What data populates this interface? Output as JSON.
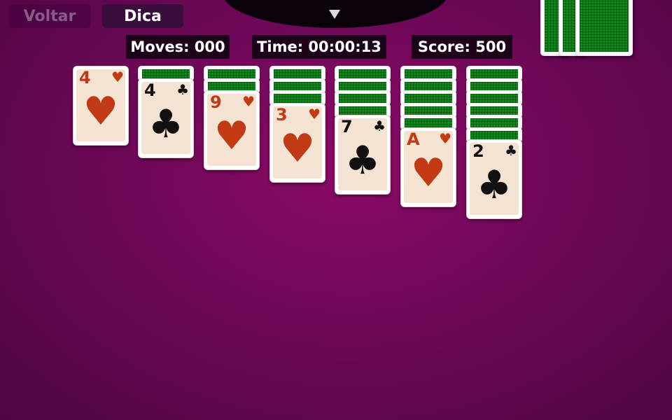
{
  "toolbar": {
    "back_label": "Voltar",
    "hint_label": "Dica"
  },
  "stats": {
    "moves": "Moves: 000",
    "time": "Time: 00:00:13",
    "score": "Score: 500"
  },
  "colors": {
    "table": "#7a0a5e",
    "red_suit": "#c23a14",
    "black_suit": "#111111",
    "card_back": "#0f8a1e",
    "card_face": "#f4e3d3"
  },
  "icons": {
    "menu": "triangle-down-icon",
    "hearts": "heart-icon",
    "clubs": "club-icon"
  },
  "tableau": [
    {
      "hidden": 0,
      "rank": "4",
      "suit": "♥",
      "color": "red"
    },
    {
      "hidden": 1,
      "rank": "4",
      "suit": "♣",
      "color": "black"
    },
    {
      "hidden": 2,
      "rank": "9",
      "suit": "♥",
      "color": "red"
    },
    {
      "hidden": 3,
      "rank": "3",
      "suit": "♥",
      "color": "red"
    },
    {
      "hidden": 4,
      "rank": "7",
      "suit": "♣",
      "color": "black"
    },
    {
      "hidden": 5,
      "rank": "A",
      "suit": "♥",
      "color": "red"
    },
    {
      "hidden": 6,
      "rank": "2",
      "suit": "♣",
      "color": "black"
    }
  ]
}
